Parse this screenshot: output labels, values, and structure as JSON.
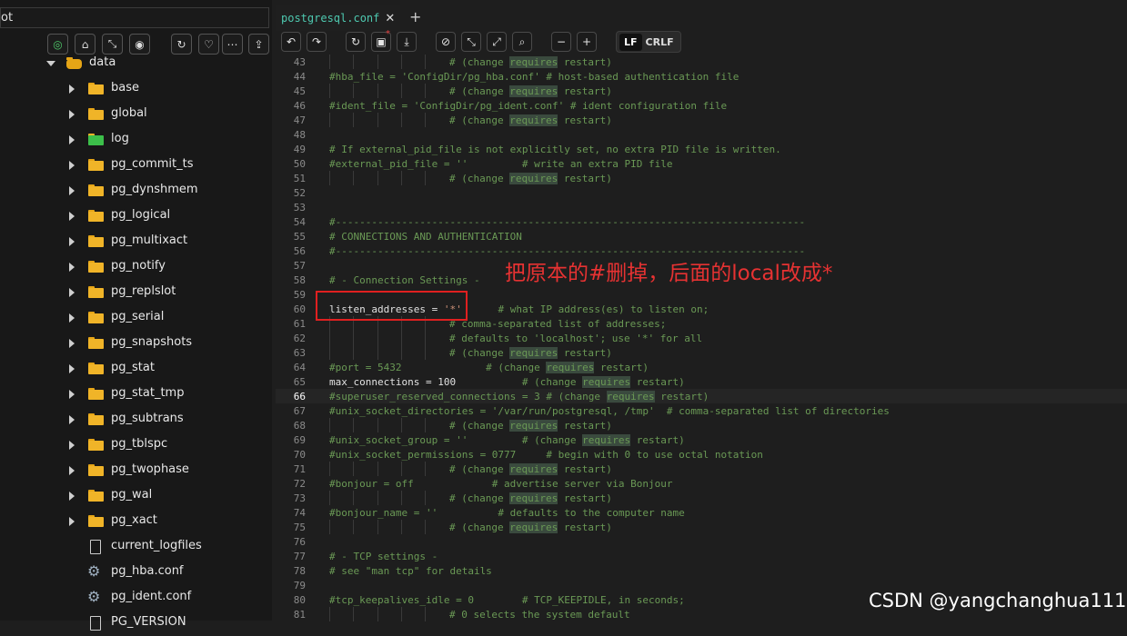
{
  "sidebar": {
    "path_value": "ot",
    "buttons": [
      "target-icon",
      "home-icon",
      "collapse-icon",
      "eye-icon",
      "refresh-icon",
      "heart-icon",
      "more-icon",
      "upload-icon"
    ],
    "tree": [
      {
        "label": "data",
        "kind": "db",
        "expanded": true
      },
      {
        "label": "base",
        "kind": "folder"
      },
      {
        "label": "global",
        "kind": "folder"
      },
      {
        "label": "log",
        "kind": "folder-green"
      },
      {
        "label": "pg_commit_ts",
        "kind": "folder"
      },
      {
        "label": "pg_dynshmem",
        "kind": "folder"
      },
      {
        "label": "pg_logical",
        "kind": "folder"
      },
      {
        "label": "pg_multixact",
        "kind": "folder"
      },
      {
        "label": "pg_notify",
        "kind": "folder"
      },
      {
        "label": "pg_replslot",
        "kind": "folder"
      },
      {
        "label": "pg_serial",
        "kind": "folder"
      },
      {
        "label": "pg_snapshots",
        "kind": "folder"
      },
      {
        "label": "pg_stat",
        "kind": "folder"
      },
      {
        "label": "pg_stat_tmp",
        "kind": "folder"
      },
      {
        "label": "pg_subtrans",
        "kind": "folder"
      },
      {
        "label": "pg_tblspc",
        "kind": "folder"
      },
      {
        "label": "pg_twophase",
        "kind": "folder"
      },
      {
        "label": "pg_wal",
        "kind": "folder"
      },
      {
        "label": "pg_xact",
        "kind": "folder"
      },
      {
        "label": "current_logfiles",
        "kind": "file"
      },
      {
        "label": "pg_hba.conf",
        "kind": "gear"
      },
      {
        "label": "pg_ident.conf",
        "kind": "gear"
      },
      {
        "label": "PG_VERSION",
        "kind": "file"
      }
    ]
  },
  "tabs": {
    "active_tab": "postgresql.conf",
    "close": "✕",
    "add": "+"
  },
  "toolbar": {
    "lf": "LF",
    "crlf": "CRLF"
  },
  "editor": {
    "active_line": 66,
    "lines": [
      {
        "n": "43",
        "t": "# (change |requires| restart)",
        "indent": 3
      },
      {
        "n": "44",
        "t": "#hba_file = 'ConfigDir/pg_hba.conf' # host-based authentication file",
        "indent": 0
      },
      {
        "n": "45",
        "t": "# (change |requires| restart)",
        "indent": 3
      },
      {
        "n": "46",
        "t": "#ident_file = 'ConfigDir/pg_ident.conf' # ident configuration file",
        "indent": 0
      },
      {
        "n": "47",
        "t": "# (change |requires| restart)",
        "indent": 3
      },
      {
        "n": "48",
        "t": "",
        "indent": 0
      },
      {
        "n": "49",
        "t": "# If external_pid_file is not explicitly set, no extra PID file is written.",
        "indent": 0
      },
      {
        "n": "50",
        "t": "#external_pid_file = ''         # write an extra PID file",
        "indent": 0
      },
      {
        "n": "51",
        "t": "# (change |requires| restart)",
        "indent": 3
      },
      {
        "n": "52",
        "t": "",
        "indent": 0
      },
      {
        "n": "53",
        "t": "",
        "indent": 0
      },
      {
        "n": "54",
        "t": "#------------------------------------------------------------------------------",
        "indent": 0
      },
      {
        "n": "55",
        "t": "# CONNECTIONS AND AUTHENTICATION",
        "indent": 0
      },
      {
        "n": "56",
        "t": "#------------------------------------------------------------------------------",
        "indent": 0
      },
      {
        "n": "57",
        "t": "",
        "indent": 0
      },
      {
        "n": "58",
        "t": "# - Connection Settings -",
        "indent": 0
      },
      {
        "n": "59",
        "t": "",
        "indent": 0
      },
      {
        "n": "60",
        "t": "listen_addresses = '*'      # what IP address(es) to listen on;",
        "indent": 0,
        "special": "listen"
      },
      {
        "n": "61",
        "t": "# comma-separated list of addresses;",
        "indent": 3
      },
      {
        "n": "62",
        "t": "# defaults to 'localhost'; use '*' for all",
        "indent": 3
      },
      {
        "n": "63",
        "t": "# (change |requires| restart)",
        "indent": 3
      },
      {
        "n": "64",
        "t": "#port = 5432              # (change |requires| restart)",
        "indent": 0
      },
      {
        "n": "65",
        "t": "max_connections = 100           # (change |requires| restart)",
        "indent": 0,
        "special": "max"
      },
      {
        "n": "66",
        "t": "#superuser_reserved_connections = 3 # (change |requires| restart)",
        "indent": 0
      },
      {
        "n": "67",
        "t": "#unix_socket_directories = '/var/run/postgresql, /tmp'  # comma-separated list of directories",
        "indent": 0
      },
      {
        "n": "68",
        "t": "# (change |requires| restart)",
        "indent": 3
      },
      {
        "n": "69",
        "t": "#unix_socket_group = ''         # (change |requires| restart)",
        "indent": 0
      },
      {
        "n": "70",
        "t": "#unix_socket_permissions = 0777     # begin with 0 to use octal notation",
        "indent": 0
      },
      {
        "n": "71",
        "t": "# (change |requires| restart)",
        "indent": 3
      },
      {
        "n": "72",
        "t": "#bonjour = off             # advertise server via Bonjour",
        "indent": 0
      },
      {
        "n": "73",
        "t": "# (change |requires| restart)",
        "indent": 3
      },
      {
        "n": "74",
        "t": "#bonjour_name = ''          # defaults to the computer name",
        "indent": 0
      },
      {
        "n": "75",
        "t": "# (change |requires| restart)",
        "indent": 3
      },
      {
        "n": "76",
        "t": "",
        "indent": 0
      },
      {
        "n": "77",
        "t": "# - TCP settings -",
        "indent": 0
      },
      {
        "n": "78",
        "t": "# see \"man tcp\" for details",
        "indent": 0
      },
      {
        "n": "79",
        "t": "",
        "indent": 0
      },
      {
        "n": "80",
        "t": "#tcp_keepalives_idle = 0        # TCP_KEEPIDLE, in seconds;",
        "indent": 0
      },
      {
        "n": "81",
        "t": "# 0 selects the system default",
        "indent": 3
      }
    ]
  },
  "annotation": {
    "text": "把原本的#删掉，后面的local改成*"
  },
  "watermark": "CSDN @yangchanghua111",
  "colors": {
    "comment": "#6a9955",
    "highlight_bg": "#3a4a3e",
    "annotation": "#e02020"
  }
}
